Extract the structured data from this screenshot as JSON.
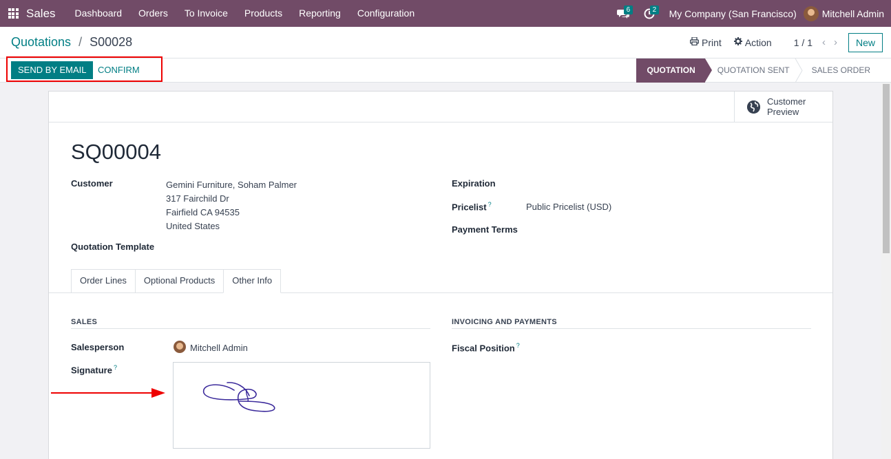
{
  "navbar": {
    "app_name": "Sales",
    "menu": [
      "Dashboard",
      "Orders",
      "To Invoice",
      "Products",
      "Reporting",
      "Configuration"
    ],
    "chat_badge": "6",
    "activity_badge": "2",
    "company": "My Company (San Francisco)",
    "user": "Mitchell Admin"
  },
  "control_panel": {
    "breadcrumb_parent": "Quotations",
    "breadcrumb_sep": "/",
    "breadcrumb_current": "S00028",
    "print_label": "Print",
    "action_label": "Action",
    "pager": "1 / 1",
    "new_label": "New"
  },
  "statusbar": {
    "send_email_label": "SEND BY EMAIL",
    "confirm_label": "CONFIRM",
    "stages": [
      "QUOTATION",
      "QUOTATION SENT",
      "SALES ORDER"
    ],
    "active_stage": "QUOTATION"
  },
  "sheet": {
    "preview_label_1": "Customer",
    "preview_label_2": "Preview",
    "title": "SQ00004",
    "customer_label": "Customer",
    "customer_lines": [
      "Gemini Furniture, Soham Palmer",
      "317 Fairchild Dr",
      "Fairfield CA 94535",
      "United States"
    ],
    "quotation_template_label": "Quotation Template",
    "expiration_label": "Expiration",
    "pricelist_label": "Pricelist",
    "pricelist_value": "Public Pricelist (USD)",
    "payment_terms_label": "Payment Terms",
    "help_mark": "?",
    "tabs": [
      "Order Lines",
      "Optional Products",
      "Other Info"
    ],
    "active_tab": "Other Info",
    "sales_section": "SALES",
    "invoicing_section": "INVOICING AND PAYMENTS",
    "salesperson_label": "Salesperson",
    "salesperson_value": "Mitchell Admin",
    "signature_label": "Signature",
    "fiscal_position_label": "Fiscal Position"
  },
  "colors": {
    "brand": "#714b67",
    "accent": "#017e84",
    "highlight": "#e00000",
    "signature_ink": "#3b2a9b"
  },
  "icons": [
    "apps-grid-icon",
    "chat-icon",
    "clock-icon",
    "print-icon",
    "gear-icon",
    "chevron-left-icon",
    "chevron-right-icon",
    "globe-icon"
  ]
}
